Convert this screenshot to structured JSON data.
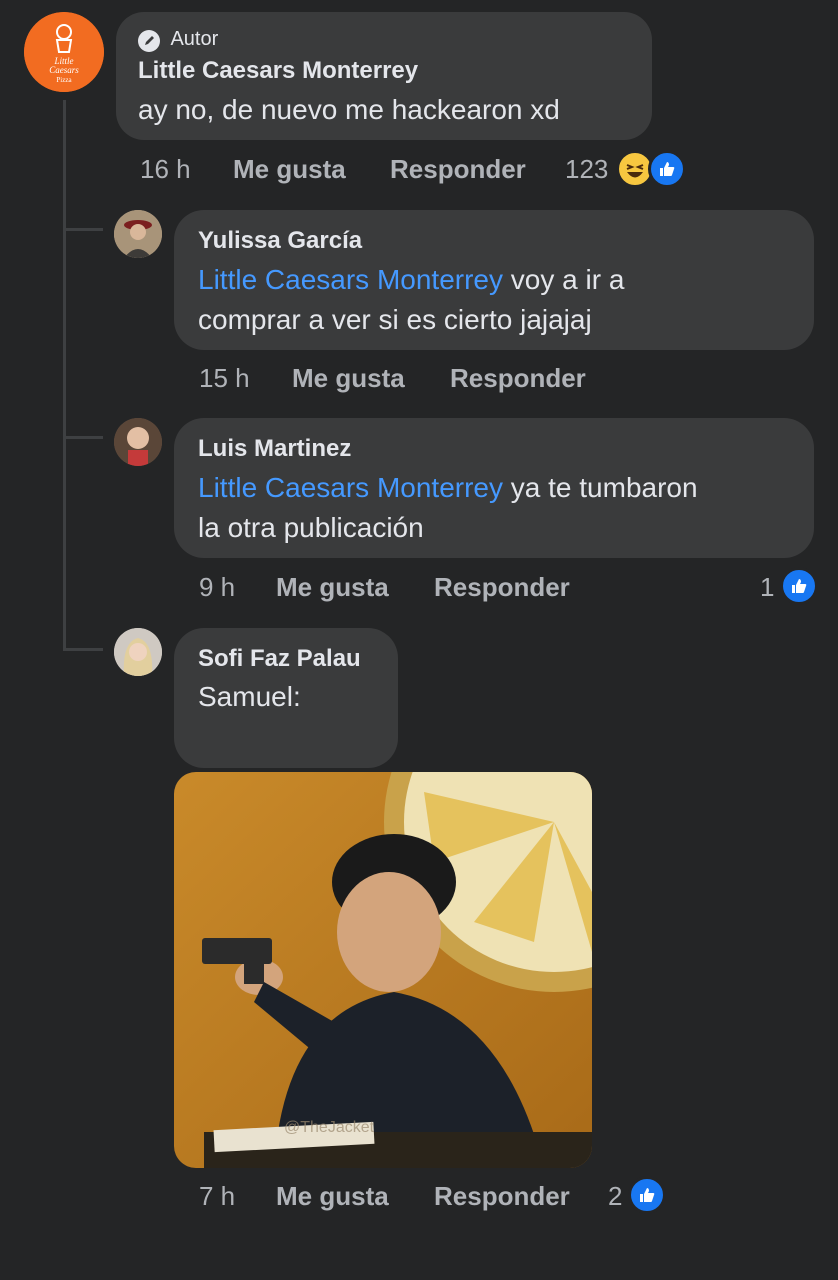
{
  "comments": [
    {
      "author": "Little Caesars Monterrey",
      "badge": "Autor",
      "text": "ay no, de nuevo me hackearon xd",
      "time": "16 h",
      "like_label": "Me gusta",
      "reply_label": "Responder",
      "reaction_count": "123",
      "reactions": [
        "haha-icon",
        "like-icon"
      ]
    },
    {
      "author": "Yulissa García",
      "mention": "Little Caesars Monterrey",
      "text_line1": " voy a ir a",
      "text_line2": "comprar a ver si es cierto jajajaj",
      "time": "15 h",
      "like_label": "Me gusta",
      "reply_label": "Responder"
    },
    {
      "author": "Luis Martinez",
      "mention": "Little Caesars Monterrey",
      "text_line1": " ya te tumbaron",
      "text_line2": "la otra publicación",
      "time": "9 h",
      "like_label": "Me gusta",
      "reply_label": "Responder",
      "reaction_count": "1",
      "reactions": [
        "like-icon"
      ]
    },
    {
      "author": "Sofi Faz Palau",
      "text": "Samuel:",
      "time": "7 h",
      "like_label": "Me gusta",
      "reply_label": "Responder",
      "reaction_count": "2",
      "reactions": [
        "like-icon"
      ],
      "photo_watermark": "@TheJacket"
    }
  ],
  "logo_text": [
    "Little",
    "Caesars",
    "Pizza"
  ],
  "colors": {
    "background": "#242526",
    "bubble": "#3a3b3c",
    "mention": "#4599ff",
    "meta": "#b0b3b8",
    "brand_orange": "#f26c21"
  }
}
